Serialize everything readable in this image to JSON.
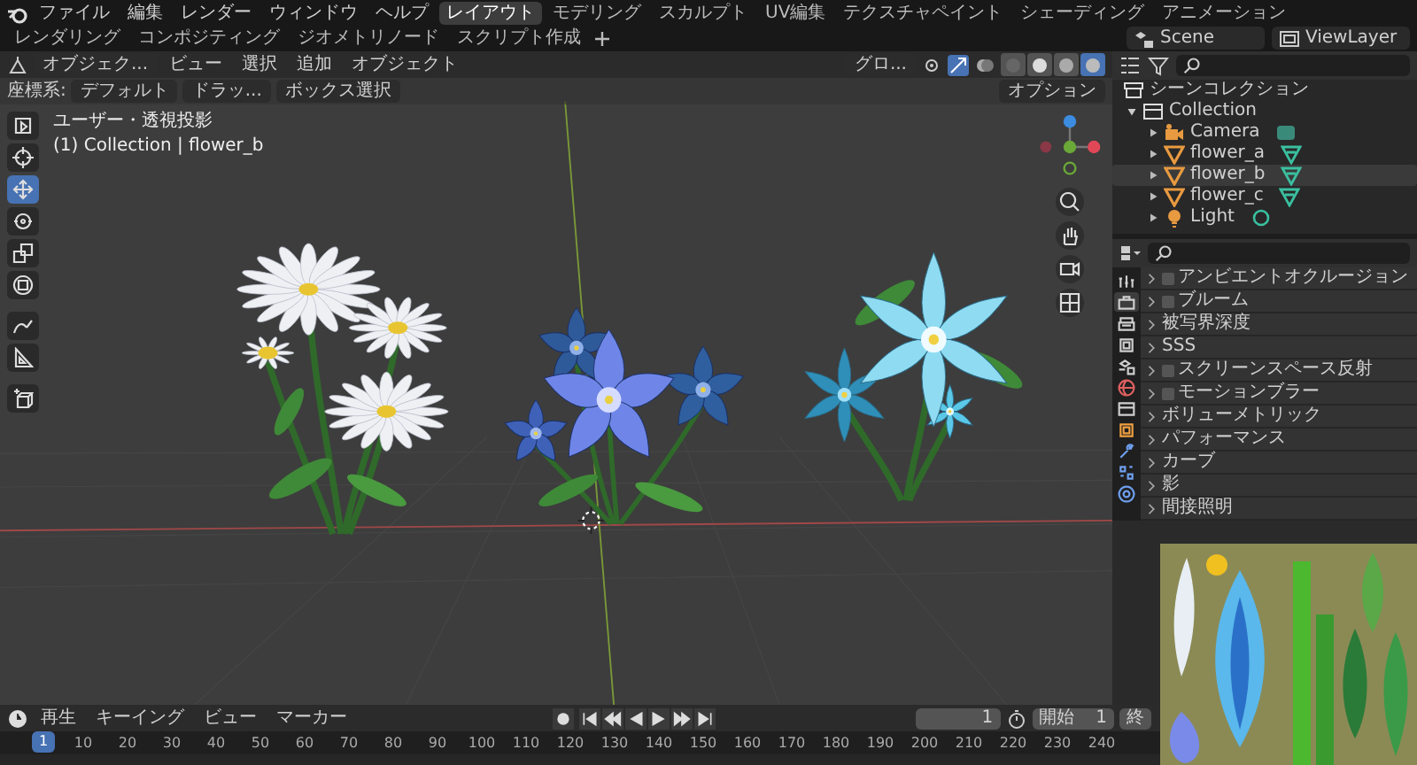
{
  "topbar": {
    "menus": [
      "ファイル",
      "編集",
      "レンダー",
      "ウィンドウ",
      "ヘルプ"
    ],
    "workspaces": [
      {
        "label": "レイアウト",
        "selected": true
      },
      {
        "label": "モデリング",
        "selected": false
      },
      {
        "label": "スカルプト",
        "selected": false
      },
      {
        "label": "UV編集",
        "selected": false
      },
      {
        "label": "テクスチャペイント",
        "selected": false
      },
      {
        "label": "シェーディング",
        "selected": false
      },
      {
        "label": "アニメーション",
        "selected": false
      },
      {
        "label": "レンダリング",
        "selected": false
      },
      {
        "label": "コンポジティング",
        "selected": false
      },
      {
        "label": "ジオメトリノード",
        "selected": false
      },
      {
        "label": "スクリプト作成",
        "selected": false
      }
    ],
    "scene": "Scene",
    "view_layer": "ViewLayer"
  },
  "viewport": {
    "mode": "オブジェク...",
    "menus": [
      "ビュー",
      "選択",
      "追加",
      "オブジェクト"
    ],
    "orientation": "グロ...",
    "shading": [
      {
        "selected": false
      },
      {
        "selected": false
      },
      {
        "selected": false
      },
      {
        "selected": true
      }
    ],
    "coord_label": "座標系:",
    "coord_value": "デフォルト",
    "drag": "ドラッ...",
    "select_mode": "ボックス選択",
    "options": "オプション",
    "view_name": "ユーザー・透視投影",
    "active_object": "(1) Collection | flower_b",
    "tools": [
      {
        "selected": false
      },
      {
        "selected": false
      },
      {
        "selected": true
      },
      {
        "selected": false
      },
      {
        "selected": false
      },
      {
        "selected": false
      },
      {
        "selected": false
      },
      {
        "selected": false
      },
      {
        "selected": false
      }
    ]
  },
  "outliner": {
    "root": "シーンコレクション",
    "items": [
      {
        "name": "Collection",
        "expanded": true,
        "children": [
          {
            "name": "Camera",
            "kind": "camera",
            "expanded": false,
            "selected": false
          },
          {
            "name": "flower_a",
            "kind": "mesh",
            "expanded": false,
            "selected": false
          },
          {
            "name": "flower_b",
            "kind": "mesh",
            "expanded": false,
            "selected": true
          },
          {
            "name": "flower_c",
            "kind": "mesh",
            "expanded": false,
            "selected": false
          },
          {
            "name": "Light",
            "kind": "light",
            "expanded": false,
            "selected": false
          }
        ]
      }
    ]
  },
  "properties": {
    "tabs": [
      {
        "selected": false
      },
      {
        "selected": true
      },
      {
        "selected": false
      },
      {
        "selected": false
      },
      {
        "selected": false
      },
      {
        "selected": false
      },
      {
        "selected": false
      },
      {
        "selected": false
      },
      {
        "selected": false
      },
      {
        "selected": false
      },
      {
        "selected": false
      }
    ],
    "panels": [
      {
        "label": "アンビエントオクルージョン",
        "kind": "toggle",
        "checked": false
      },
      {
        "label": "ブルーム",
        "kind": "toggle",
        "checked": false
      },
      {
        "label": "被写界深度",
        "kind": "plain"
      },
      {
        "label": "SSS",
        "kind": "plain"
      },
      {
        "label": "スクリーンスペース反射",
        "kind": "toggle",
        "checked": false
      },
      {
        "label": "モーションブラー",
        "kind": "toggle",
        "checked": false
      },
      {
        "label": "ボリューメトリック",
        "kind": "plain"
      },
      {
        "label": "パフォーマンス",
        "kind": "plain"
      },
      {
        "label": "カーブ",
        "kind": "plain"
      },
      {
        "label": "影",
        "kind": "plain"
      },
      {
        "label": "間接照明",
        "kind": "plain"
      }
    ]
  },
  "timeline": {
    "menus": [
      "再生",
      "キーイング",
      "ビュー",
      "マーカー"
    ],
    "current_frame": "1",
    "start_label": "開始",
    "start": "1",
    "end_label": "終",
    "playhead": "1",
    "ticks": [
      "10",
      "20",
      "30",
      "40",
      "50",
      "60",
      "70",
      "80",
      "90",
      "100",
      "110",
      "120",
      "130",
      "140",
      "150",
      "160",
      "170",
      "180",
      "190",
      "200",
      "210",
      "220",
      "230",
      "240"
    ]
  }
}
